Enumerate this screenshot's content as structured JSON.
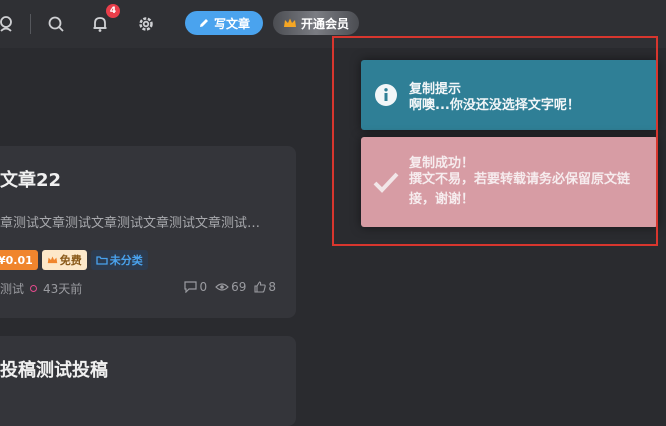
{
  "header": {
    "notification_count": "4",
    "write_label": "写文章",
    "vip_label": "开通会员"
  },
  "posts": [
    {
      "title": "文章22",
      "excerpt": "章测试文章测试文章测试文章测试文章测试…",
      "price": "¥0.01",
      "free_label": "免费",
      "category": "未分类",
      "author": "测试",
      "time": "43天前",
      "comments": "0",
      "views": "69",
      "likes": "8"
    },
    {
      "title": "投稿测试投稿"
    }
  ],
  "toasts": {
    "info": {
      "title": "复制提示",
      "message": "啊噢...你没还没选择文字呢！",
      "color": "#2f7f96"
    },
    "success": {
      "title": "复制成功！",
      "message": "撰文不易，若要转载请务必保留原文链接，谢谢！",
      "color": "#d79ca4"
    }
  },
  "highlight_color": "#d8362e"
}
